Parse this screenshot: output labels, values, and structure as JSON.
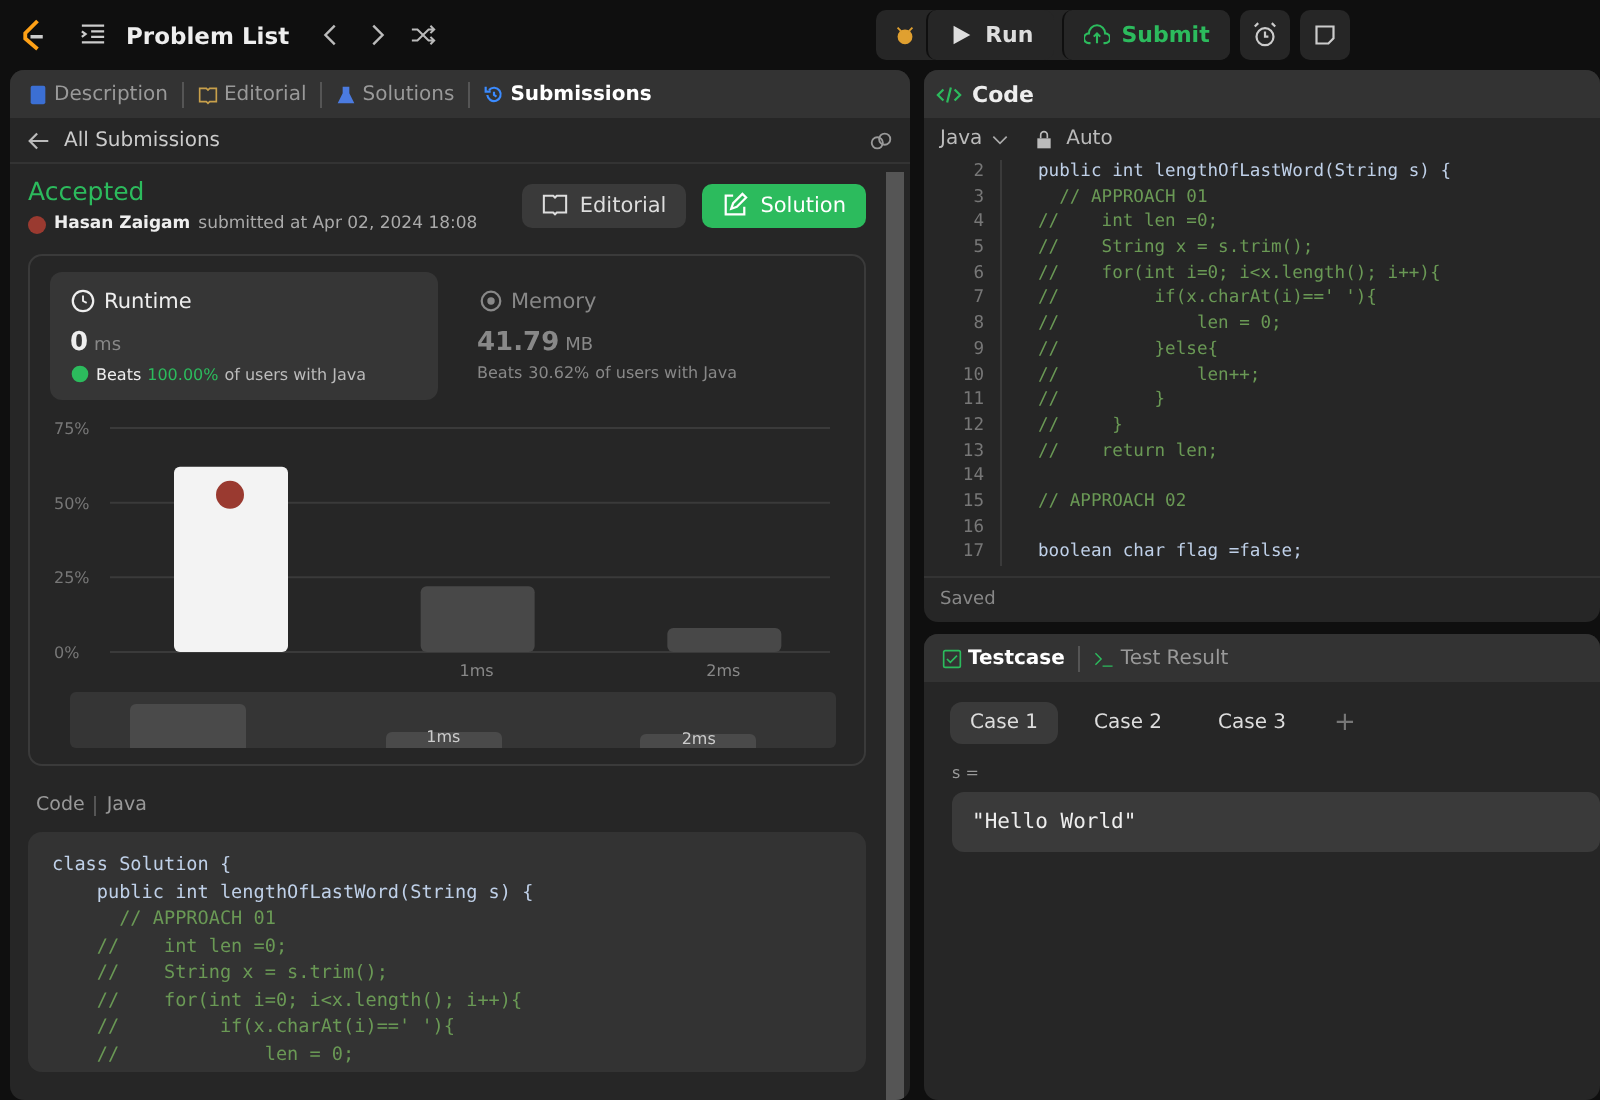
{
  "topbar": {
    "title": "Problem List",
    "buttons": [
      {
        "label": "Run",
        "kind": "run"
      },
      {
        "label": "Submit",
        "kind": "submit"
      }
    ]
  },
  "tabs": [
    {
      "label": "Description",
      "selected": false
    },
    {
      "label": "Editorial",
      "selected": false
    },
    {
      "label": "Solutions",
      "selected": false
    },
    {
      "label": "Submissions",
      "selected": true
    }
  ],
  "back_link": "All Submissions",
  "submission": {
    "status": "Accepted",
    "user": "Hasan Zaigam",
    "submitted": "submitted at Apr 02, 2024 18:08",
    "buttons": [
      {
        "label": "Editorial",
        "kind": "secondary"
      },
      {
        "label": "Solution",
        "kind": "primary"
      }
    ]
  },
  "stats": [
    {
      "title": "Runtime",
      "kind": "clock",
      "selected": true,
      "value": "0",
      "unit": "ms",
      "beats_label": "Beats",
      "beats": "100.00%",
      "suffix": "of users with Java"
    },
    {
      "title": "Memory",
      "kind": "chip",
      "selected": false,
      "value": "41.79",
      "unit": "MB",
      "beats_label": "Beats",
      "beats": "30.62%",
      "suffix": "of users with Java"
    }
  ],
  "chart_data": {
    "type": "bar",
    "categories": [
      null,
      "1ms",
      "2ms"
    ],
    "values": [
      62,
      22,
      8
    ],
    "ylim": [
      0,
      75
    ],
    "yticks": [
      {
        "value": 0,
        "label": "0%"
      },
      {
        "value": 25,
        "label": "25%"
      },
      {
        "value": 50,
        "label": "50%"
      },
      {
        "value": 75,
        "label": "75%"
      }
    ]
  },
  "overview_labels": [
    "1ms",
    "2ms"
  ],
  "code_header": {
    "title": "Code",
    "language": "Java"
  },
  "submitted_code": [
    {
      "text": "class Solution {",
      "kind": "code"
    },
    {
      "text": "    public int lengthOfLastWord(String s) {",
      "kind": "code"
    },
    {
      "text": "      // APPROACH 01",
      "kind": "comment"
    },
    {
      "text": "    //    int len =0;",
      "kind": "comment"
    },
    {
      "text": "    //    String x = s.trim();",
      "kind": "comment"
    },
    {
      "text": "    //    for(int i=0; i<x.length(); i++){",
      "kind": "comment"
    },
    {
      "text": "    //         if(x.charAt(i)==' '){",
      "kind": "comment"
    },
    {
      "text": "    //             len = 0;",
      "kind": "comment"
    }
  ],
  "editor": {
    "title": "Code",
    "language": "Java",
    "mode": "Auto",
    "status": "Saved",
    "lines": [
      {
        "no": "2",
        "text": "public int lengthOfLastWord(String s) {",
        "kind": "code"
      },
      {
        "no": "3",
        "text": "  // APPROACH 01",
        "kind": "comment"
      },
      {
        "no": "4",
        "text": "//    int len =0;",
        "kind": "comment"
      },
      {
        "no": "5",
        "text": "//    String x = s.trim();",
        "kind": "comment"
      },
      {
        "no": "6",
        "text": "//    for(int i=0; i<x.length(); i++){",
        "kind": "comment"
      },
      {
        "no": "7",
        "text": "//         if(x.charAt(i)==' '){",
        "kind": "comment"
      },
      {
        "no": "8",
        "text": "//             len = 0;",
        "kind": "comment"
      },
      {
        "no": "9",
        "text": "//         }else{",
        "kind": "comment"
      },
      {
        "no": "10",
        "text": "//             len++;",
        "kind": "comment"
      },
      {
        "no": "11",
        "text": "//         }",
        "kind": "comment"
      },
      {
        "no": "12",
        "text": "//     }",
        "kind": "comment"
      },
      {
        "no": "13",
        "text": "//    return len;",
        "kind": "comment"
      },
      {
        "no": "14"
      },
      {
        "no": "15",
        "text": "// APPROACH 02",
        "kind": "comment"
      },
      {
        "no": "16"
      },
      {
        "no": "17",
        "text": "boolean char flag =false;",
        "kind": "code"
      }
    ]
  },
  "testcase": {
    "tabs": [
      {
        "label": "Testcase",
        "selected": true
      },
      {
        "label": "Test Result",
        "selected": false
      }
    ],
    "cases": [
      {
        "label": "Case 1",
        "selected": true
      },
      {
        "label": "Case 2",
        "selected": false
      },
      {
        "label": "Case 3",
        "selected": false
      }
    ],
    "add": "+",
    "var_label": "s =",
    "value": "\"Hello World\""
  }
}
